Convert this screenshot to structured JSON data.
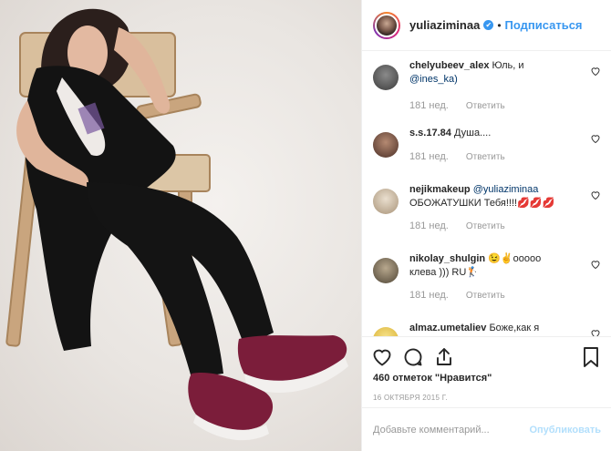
{
  "post": {
    "image_alt": "Photo of a woman in a black vest and trousers sitting in a wooden chair"
  },
  "header": {
    "username": "yuliaziminaa",
    "verified_glyph": "✔",
    "separator": "•",
    "follow_label": "Подписаться"
  },
  "comments": [
    {
      "user": "chelyubeev_alex",
      "text": "Юль, и ",
      "mention": "@ines_ka)",
      "time": "181 нед.",
      "reply": "Ответить",
      "avatar_color": "#3b3b3b"
    },
    {
      "user": "s.s.17.84",
      "text": "Душа....",
      "mention": "",
      "time": "181 нед.",
      "reply": "Ответить",
      "avatar_color": "#6b4a3a"
    },
    {
      "user": "nejikmakeup",
      "text": "",
      "mention": "@yuliaziminaa",
      "text2": "ОБОЖАТУШКИ Тебя!!!!💋💋💋",
      "time": "181 нед.",
      "reply": "Ответить",
      "avatar_color": "#c8b9a4"
    },
    {
      "user": "nikolay_shulgin",
      "text": "😉✌ooooo",
      "text2": "клева ))) RU🏌",
      "mention": "",
      "time": "181 нед.",
      "reply": "Ответить",
      "avatar_color": "#7a6a55"
    },
    {
      "user": "almaz.umetaliev",
      "text": "Боже,как я",
      "mention": "",
      "time": "",
      "reply": "",
      "avatar_color": "#e8c84a"
    }
  ],
  "actions": {
    "likes_text": "460 отметок \"Нравится\"",
    "date": "16 ОКТЯБРЯ 2015 Г."
  },
  "add_comment": {
    "placeholder": "Добавьте комментарий...",
    "publish_label": "Опубликовать"
  },
  "colors": {
    "link": "#3897f0",
    "mention": "#003569",
    "muted": "#999999",
    "border": "#efefef"
  },
  "icons": [
    "heart-icon",
    "comment-icon",
    "share-icon",
    "bookmark-icon",
    "verified-icon",
    "like-small-icon"
  ]
}
